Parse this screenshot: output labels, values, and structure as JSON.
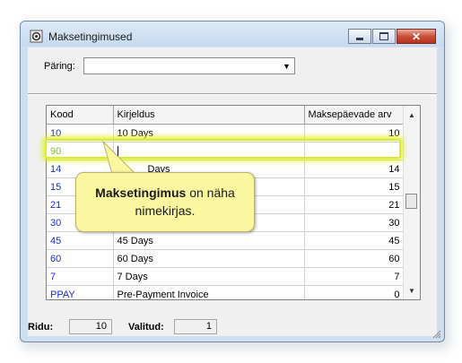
{
  "window": {
    "title": "Maksetingimused"
  },
  "filter": {
    "label": "Päring:",
    "value": ""
  },
  "grid": {
    "columns": [
      "Kood",
      "Kirjeldus",
      "Maksepäevade arv"
    ],
    "rows": [
      {
        "kood": "10",
        "kirjeldus": "10 Days",
        "arv": "10"
      },
      {
        "kood": "90",
        "kirjeldus": "",
        "arv": ""
      },
      {
        "kood": "14",
        "kirjeldus": "Days",
        "arv": "14"
      },
      {
        "kood": "15",
        "kirjeldus": "",
        "arv": "15"
      },
      {
        "kood": "21",
        "kirjeldus": "",
        "arv": "21"
      },
      {
        "kood": "30",
        "kirjeldus": "",
        "arv": "30"
      },
      {
        "kood": "45",
        "kirjeldus": "45 Days",
        "arv": "45"
      },
      {
        "kood": "60",
        "kirjeldus": "60 Days",
        "arv": "60"
      },
      {
        "kood": "7",
        "kirjeldus": "7 Days",
        "arv": "7"
      },
      {
        "kood": "PPAY",
        "kirjeldus": "Pre-Payment Invoice",
        "arv": "0"
      }
    ]
  },
  "callout": {
    "bold": "Maksetingimus",
    "rest": " on näha nimekirjas."
  },
  "status": {
    "ridu_label": "Ridu:",
    "ridu_value": "10",
    "valitud_label": "Valitud:",
    "valitud_value": "1"
  },
  "colors": {
    "code_text": "#1a2bd6",
    "new_code_text": "#7cbf20",
    "highlight": "#dcec2a",
    "callout_bg": "#fbf6a0"
  }
}
